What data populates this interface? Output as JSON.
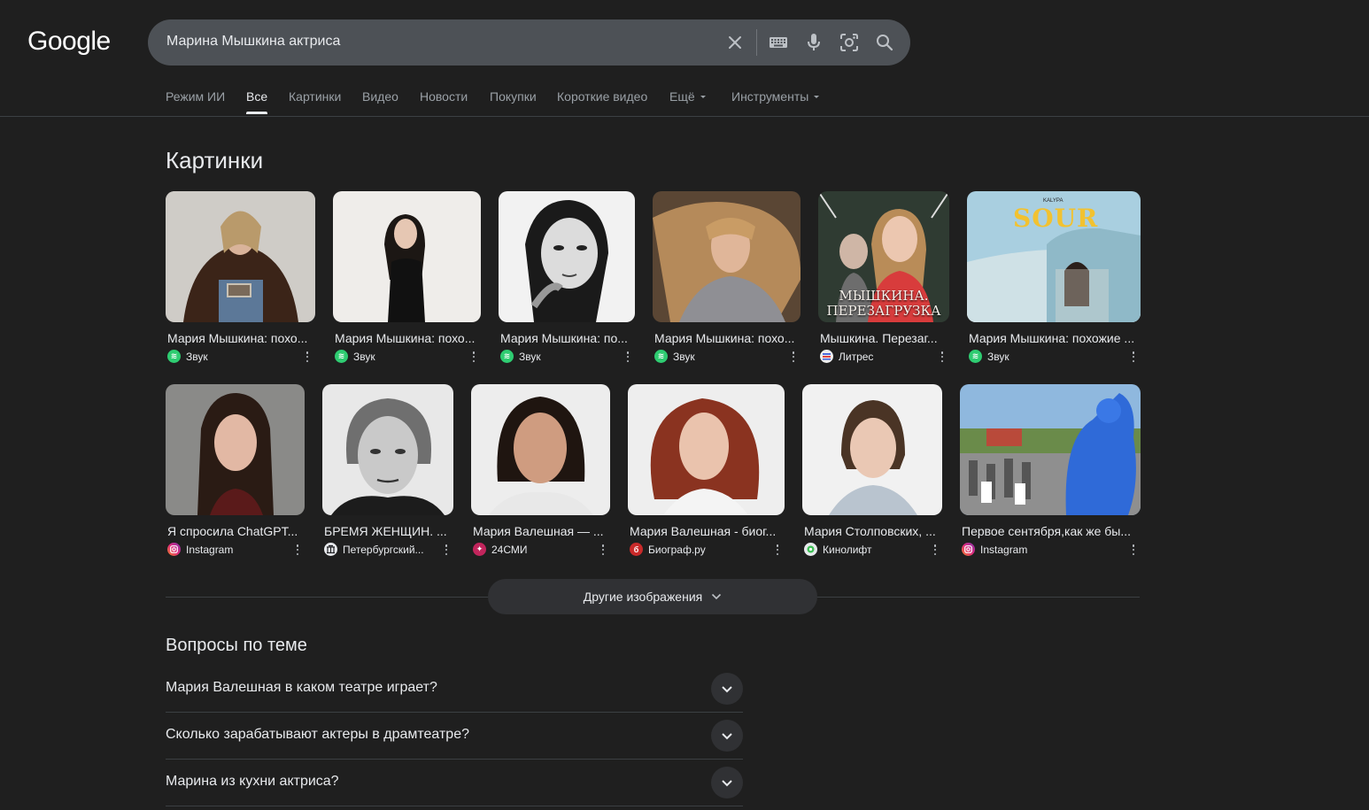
{
  "header": {
    "logo_text": "Google",
    "search_value": "Марина Мышкина актриса",
    "icons": [
      "close-icon",
      "keyboard-icon",
      "microphone-icon",
      "lens-icon",
      "search-icon"
    ]
  },
  "tabs": [
    {
      "label": "Режим ИИ"
    },
    {
      "label": "Все",
      "active": true
    },
    {
      "label": "Картинки"
    },
    {
      "label": "Видео"
    },
    {
      "label": "Новости"
    },
    {
      "label": "Покупки"
    },
    {
      "label": "Короткие видео"
    },
    {
      "label": "Ещё",
      "dropdown": true
    },
    {
      "label": "Инструменты",
      "dropdown": true
    }
  ],
  "images_section": {
    "title": "Картинки",
    "row1": [
      {
        "title": "Мария Мышкина: похо...",
        "source": "Звук"
      },
      {
        "title": "Мария Мышкина: похо...",
        "source": "Звук"
      },
      {
        "title": "Мария Мышкина: по...",
        "source": "Звук"
      },
      {
        "title": "Мария Мышкина: похо...",
        "source": "Звук"
      },
      {
        "title": "Мышкина. Перезаг...",
        "source": "Литрес",
        "overlay": "МЫШКИНА. ПЕРЕЗАГРУЗКА"
      },
      {
        "title": "Мария Мышкина: похожие ...",
        "source": "Звук",
        "overlay": "SOUR",
        "overlay_small": "KALYPA"
      }
    ],
    "row2": [
      {
        "title": "Я спросила ChatGPT...",
        "source": "Instagram"
      },
      {
        "title": "БРЕМЯ ЖЕНЩИН. ...",
        "source": "Петербургский..."
      },
      {
        "title": "Мария Валешная — ...",
        "source": "24СМИ"
      },
      {
        "title": "Мария Валешная - биог...",
        "source": "Биограф.ру"
      },
      {
        "title": "Мария Столповских, ...",
        "source": "Кинолифт"
      },
      {
        "title": "Первое сентября,как же бы...",
        "source": "Instagram"
      }
    ],
    "more_button": "Другие изображения"
  },
  "paa": {
    "title": "Вопросы по теме",
    "questions": [
      "Мария Валешная в каком театре играет?",
      "Сколько зарабатывают актеры в драмтеатре?",
      "Марина из кухни актриса?"
    ]
  },
  "colors": {
    "background": "#1f1f1f",
    "search_bg": "#4d5156",
    "text": "#e8eaed",
    "muted": "#9aa0a6",
    "zvuk": "#2ecc71",
    "instagram": "#e1306c",
    "litres": "#3b5bdb"
  }
}
